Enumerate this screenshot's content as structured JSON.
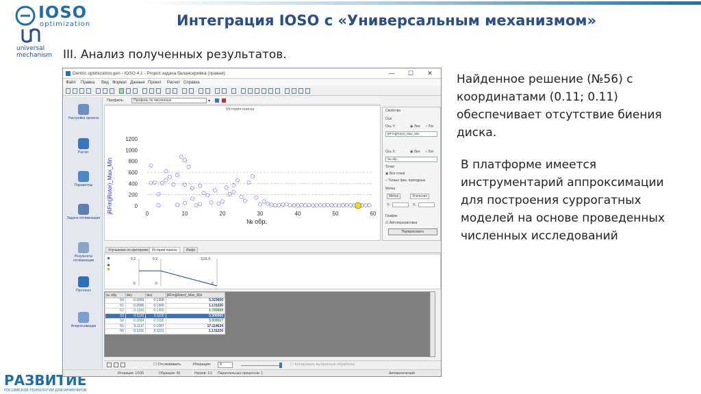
{
  "slide": {
    "title": "Интеграция IOSO с «Универсальным механизмом»",
    "section_title": "III. Анализ полученных результатов.",
    "found_solution": "Найденное решение (№56) с координатами (0.11; 0.11) обеспечивает отсутствие биения диска.",
    "platform_text": "В платформе имеется инструментарий аппроксимации для построения суррогатных моделей на основе проведенных численных исследований"
  },
  "logos": {
    "ioso_word": "IOSO",
    "ioso_sub": "optimization",
    "um_line1": "universal",
    "um_line2": "mechanism",
    "razvitie_word": "РАЗВИТИЕ",
    "razvitie_sub": "РОССИЙСКОЕ ТЕХНОЛОГИИ ДЛЯ ИНЖЕНЕРОВ"
  },
  "window": {
    "title": "Dentric optimization.gen - IOSO 4.1 - Project задача балансировка (правая)",
    "controls": {
      "minimize": "—",
      "maximize": "☐",
      "close": "✕"
    },
    "menu": [
      "Файл",
      "Правка",
      "Вид",
      "Формат",
      "Данные",
      "Проект",
      "Расчет",
      "Справка"
    ]
  },
  "nav": [
    {
      "label": "Настройка проекта"
    },
    {
      "label": "Расчет"
    },
    {
      "label": "Параметры"
    },
    {
      "label": "Задача оптимизации"
    },
    {
      "label": "Результаты оптимизации"
    },
    {
      "label": "Протокол"
    },
    {
      "label": "Аппроксимация"
    }
  ],
  "plot_toolbar": {
    "profile_label": "Профиль:",
    "profile_value": "Профиль по численные"
  },
  "plot": {
    "caption": "История поиска"
  },
  "props": {
    "header": "Свойства",
    "axes": "Оси",
    "y_axis": "Ось Y:",
    "y_lin": "Лин",
    "y_log": "Лог",
    "y_field": "jRFm(jRotor)_Max_Min",
    "x_axis": "Ось X:",
    "x_lin": "Лин",
    "x_log": "Лог",
    "x_field": "№ обр.",
    "points": "Точки",
    "all_points": "Все точки",
    "valid_only": "Только физ. пригодные",
    "mark": "Метка",
    "mark_tab1": "Метка",
    "mark_tab2": "Значения",
    "coord_y": "Y:",
    "coord_x": "X:",
    "graph": "График",
    "auto_redraw": "Автоперерисовка",
    "redraw_btn": "Перерисовать"
  },
  "tabs": [
    {
      "label": "Улучшение по критериям"
    },
    {
      "label": "История поиска"
    },
    {
      "label": "Инфо"
    }
  ],
  "history": {
    "v1_top": "0.2",
    "v1_bottom": "0",
    "v2_top": "0.2",
    "v2_bottom": "0",
    "v3_top": "1111.0",
    "v3_bottom": "0"
  },
  "table": {
    "columns": [
      "№ обр.",
      "dey",
      "dez",
      "jRFm(jRotor)_Max_Min"
    ],
    "rows": [
      [
        "50",
        "0.1093",
        "0.1308",
        "5.323600"
      ],
      [
        "51",
        "0.1096",
        "0.1300",
        "1.131226"
      ],
      [
        "52",
        "0.1100",
        "0.1300",
        "1.789898"
      ],
      [
        "53",
        "0.1100",
        "0.1100",
        "0.300000"
      ],
      [
        "54",
        "0.1094",
        "0.1095",
        "3.309517"
      ],
      [
        "55",
        "0.1117",
        "0.1087",
        "17.114624"
      ],
      [
        "56",
        "0.1101",
        "0.1101",
        "1.131226"
      ]
    ]
  },
  "bottom_bar": {
    "step_label": "Отслеживать",
    "iterations_label": "Итерация:",
    "iterations_value": "6",
    "save_hint": "Копировать выбранную обработку"
  },
  "status": {
    "iterations": "Итерация: 1/100",
    "samples": "Образцов: 56",
    "stage": "Нагрев: 1/1",
    "parallel": "Параллельных процессов: 1",
    "mode": "Автоматический"
  },
  "chart_data": {
    "type": "scatter",
    "xlabel": "№ обр.",
    "ylabel": "jRFm(jRotor)_Max_Min",
    "xlim": [
      0,
      60
    ],
    "ylim": [
      0,
      1200
    ],
    "xticks": [
      0,
      10,
      20,
      30,
      40,
      50,
      60
    ],
    "yticks": [
      0,
      200,
      400,
      600,
      800,
      1000,
      1200
    ],
    "grid": false,
    "points": [
      [
        1,
        720
      ],
      [
        1,
        410
      ],
      [
        2,
        420
      ],
      [
        3,
        210
      ],
      [
        3,
        10
      ],
      [
        4,
        410
      ],
      [
        5,
        620
      ],
      [
        5,
        460
      ],
      [
        6,
        520
      ],
      [
        7,
        380
      ],
      [
        8,
        20
      ],
      [
        8,
        550
      ],
      [
        9,
        880
      ],
      [
        10,
        820
      ],
      [
        10,
        380
      ],
      [
        10,
        50
      ],
      [
        11,
        700
      ],
      [
        12,
        320
      ],
      [
        12,
        130
      ],
      [
        13,
        10
      ],
      [
        14,
        360
      ],
      [
        14,
        30
      ],
      [
        15,
        230
      ],
      [
        16,
        190
      ],
      [
        17,
        60
      ],
      [
        18,
        280
      ],
      [
        19,
        40
      ],
      [
        20,
        80
      ],
      [
        21,
        330
      ],
      [
        22,
        210
      ],
      [
        23,
        250
      ],
      [
        23,
        370
      ],
      [
        24,
        460
      ],
      [
        25,
        160
      ],
      [
        26,
        90
      ],
      [
        27,
        420
      ],
      [
        28,
        530
      ],
      [
        29,
        150
      ],
      [
        30,
        30
      ],
      [
        31,
        80
      ],
      [
        32,
        40
      ],
      [
        33,
        20
      ],
      [
        34,
        15
      ],
      [
        35,
        10
      ],
      [
        36,
        20
      ],
      [
        37,
        30
      ],
      [
        38,
        15
      ],
      [
        39,
        10
      ],
      [
        40,
        8
      ],
      [
        41,
        12
      ],
      [
        42,
        10
      ],
      [
        43,
        15
      ],
      [
        44,
        8
      ],
      [
        45,
        10
      ],
      [
        46,
        12
      ],
      [
        47,
        8
      ],
      [
        48,
        15
      ],
      [
        49,
        10
      ],
      [
        50,
        12
      ],
      [
        51,
        8
      ],
      [
        52,
        10
      ],
      [
        53,
        12
      ],
      [
        54,
        8
      ],
      [
        55,
        10
      ],
      [
        56,
        5
      ],
      [
        57,
        10
      ],
      [
        58,
        8
      ],
      [
        59,
        12
      ]
    ],
    "highlight": [
      56,
      5
    ],
    "highlight_color": "#f2e200",
    "point_color": "#3030c8"
  },
  "colors": {
    "brand_blue": "#1e6fa8",
    "title_blue": "#2a4e8a",
    "selection": "#3b6fb8",
    "axis_label_blue": "#2a2ad0"
  }
}
